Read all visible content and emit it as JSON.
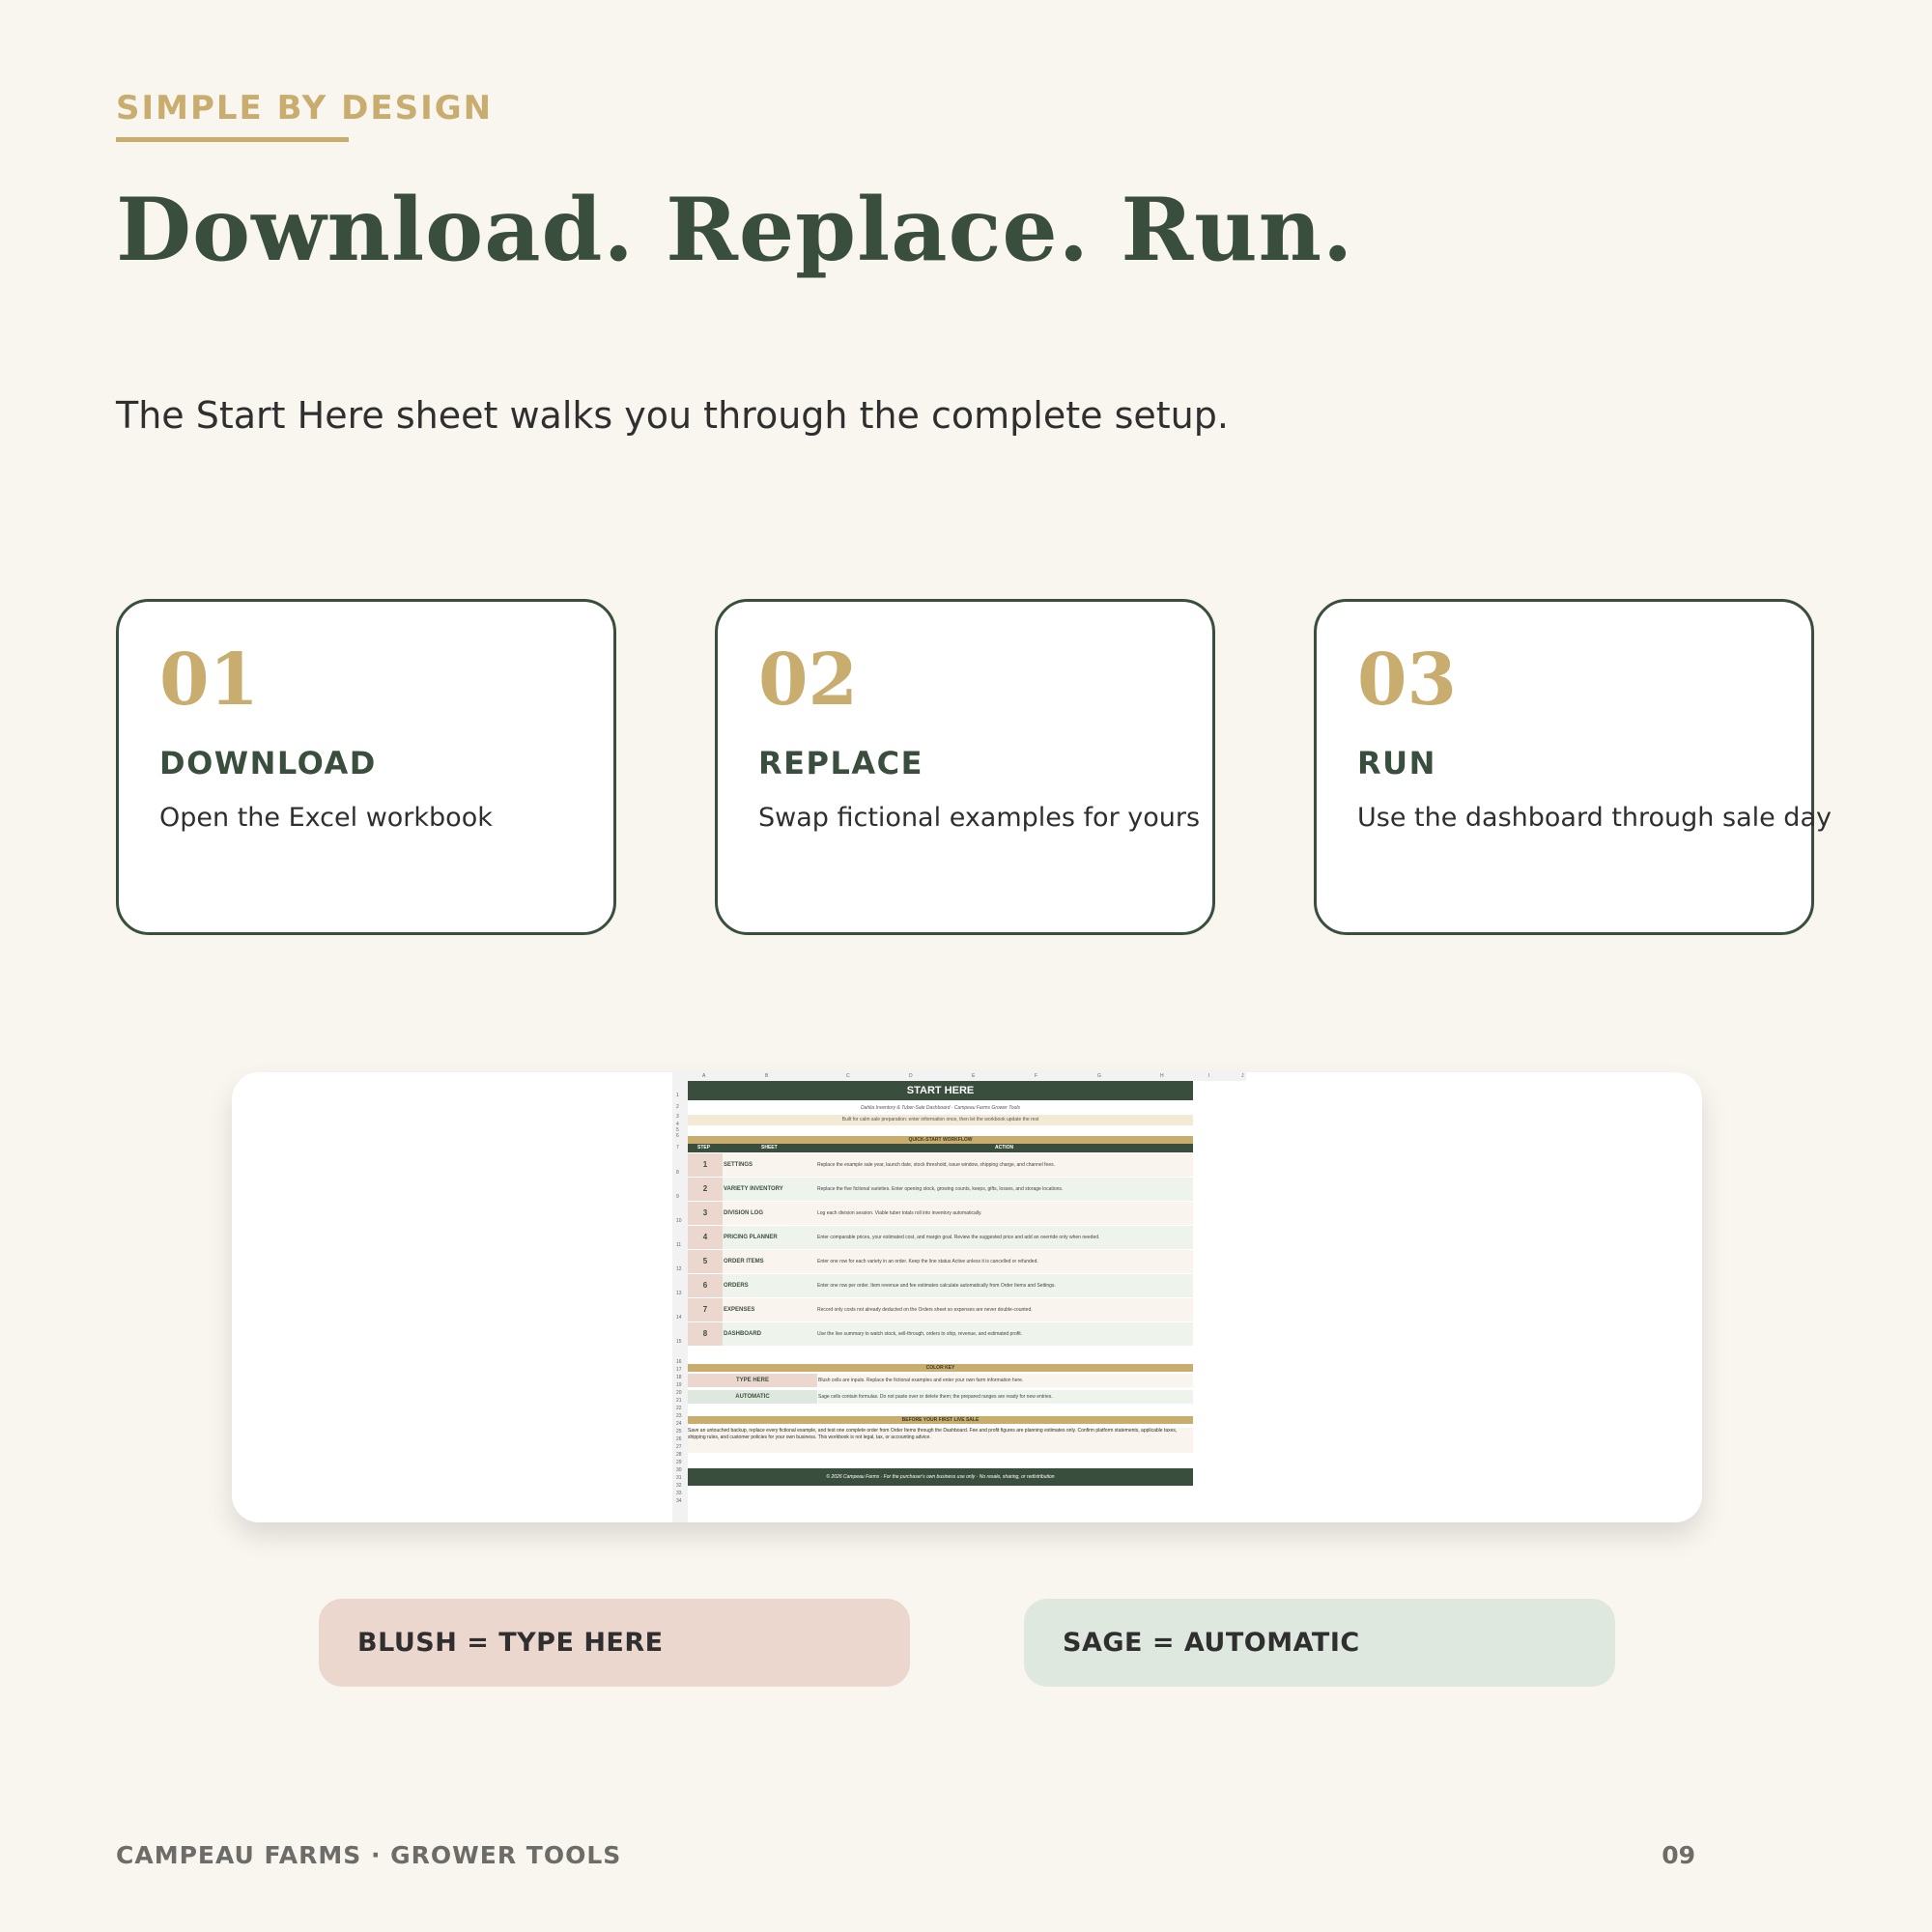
{
  "eyebrow": "SIMPLE BY DESIGN",
  "headline": "Download. Replace. Run.",
  "subhead": "The Start Here sheet walks you through the complete setup.",
  "steps": [
    {
      "num": "01",
      "title": "DOWNLOAD",
      "desc": "Open the Excel workbook"
    },
    {
      "num": "02",
      "title": "REPLACE",
      "desc": "Swap fictional examples for yours"
    },
    {
      "num": "03",
      "title": "RUN",
      "desc": "Use the dashboard through sale day"
    }
  ],
  "sheet": {
    "columns": [
      "A",
      "B",
      "C",
      "D",
      "E",
      "F",
      "G",
      "H",
      "I",
      "J"
    ],
    "title": "START HERE",
    "subtitle": "Dahlia Inventory & Tuber-Sale Dashboard · Campeau Farms Grower Tools",
    "note": "Built for calm sale preparation: enter information once, then let the workbook update the rest",
    "workflow_header": "QUICK-START WORKFLOW",
    "table_headers": {
      "step": "STEP",
      "sheet": "SHEET",
      "action": "ACTION"
    },
    "workflow": [
      {
        "step": "1",
        "sheet": "SETTINGS",
        "action": "Replace the example sale year, launch date, stock threshold, issue window, shipping charge, and channel fees."
      },
      {
        "step": "2",
        "sheet": "VARIETY INVENTORY",
        "action": "Replace the five fictional varieties. Enter opening stock, growing counts, keeps, gifts, losses, and storage locations."
      },
      {
        "step": "3",
        "sheet": "DIVISION LOG",
        "action": "Log each division session. Viable tuber totals roll into inventory automatically."
      },
      {
        "step": "4",
        "sheet": "PRICING PLANNER",
        "action": "Enter comparable prices, your estimated cost, and margin goal. Review the suggested price and add an override only when needed."
      },
      {
        "step": "5",
        "sheet": "ORDER ITEMS",
        "action": "Enter one row for each variety in an order. Keep the line status Active unless it is cancelled or refunded."
      },
      {
        "step": "6",
        "sheet": "ORDERS",
        "action": "Enter one row per order. Item revenue and fee estimates calculate automatically from Order Items and Settings."
      },
      {
        "step": "7",
        "sheet": "EXPENSES",
        "action": "Record only costs not already deducted on the Orders sheet so expenses are never double-counted."
      },
      {
        "step": "8",
        "sheet": "DASHBOARD",
        "action": "Use the live summary to watch stock, sell-through, orders to ship, revenue, and estimated profit."
      }
    ],
    "color_key_header": "COLOR KEY",
    "color_key": [
      {
        "key": "TYPE HERE",
        "desc": "Blush cells are inputs. Replace the fictional examples and enter your own farm information here."
      },
      {
        "key": "AUTOMATIC",
        "desc": "Sage cells contain formulas. Do not paste over or delete them; the prepared ranges are ready for new entries."
      }
    ],
    "first_sale_header": "BEFORE YOUR FIRST LIVE SALE",
    "first_sale_text": "Save an untouched backup, replace every fictional example, and test one complete order from Order Items through the Dashboard. Fee and profit figures are planning estimates only. Confirm platform statements, applicable taxes, shipping rules, and customer policies for your own business. This workbook is not legal, tax, or accounting advice.",
    "footer": "© 2026 Campeau Farms · For the purchaser's own business use only · No resale, sharing, or redistribution"
  },
  "legend": {
    "blush": "BLUSH = TYPE HERE",
    "sage": "SAGE = AUTOMATIC"
  },
  "colors": {
    "cream": "#f9f5ef",
    "forest": "#3a4e3e",
    "gold": "#c8ad6f",
    "blush": "#ecd7cf",
    "sage": "#dfe8df"
  },
  "footer": {
    "brand": "CAMPEAU FARMS · GROWER TOOLS",
    "page": "09"
  }
}
